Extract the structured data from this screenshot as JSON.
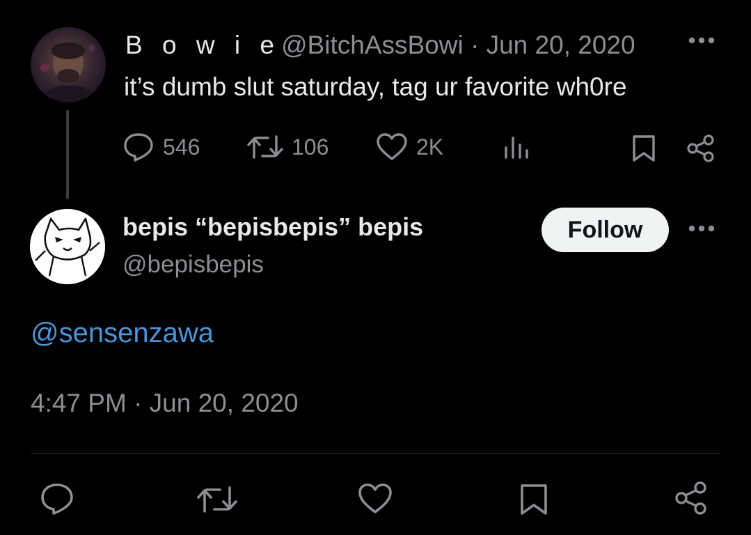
{
  "parent_tweet": {
    "display_name": "B o w i e",
    "handle": "@BitchAssBowi",
    "separator": "·",
    "date": "Jun 20, 2020",
    "text": "it’s dumb slut saturday, tag ur favorite wh0re",
    "actions": {
      "reply_count": "546",
      "retweet_count": "106",
      "like_count": "2K"
    },
    "icons": [
      "reply-icon",
      "retweet-icon",
      "like-icon",
      "views-icon",
      "bookmark-icon",
      "share-icon",
      "more-icon"
    ]
  },
  "reply_tweet": {
    "display_name": "bepis “bepisbepis” bepis",
    "handle": "@bepisbepis",
    "follow_label": "Follow",
    "text": "@sensenzawa",
    "timestamp": "4:47 PM · Jun 20, 2020",
    "icons": [
      "reply-icon",
      "retweet-icon",
      "like-icon",
      "bookmark-icon",
      "share-icon",
      "more-icon"
    ]
  },
  "colors": {
    "background": "#000000",
    "text_primary": "#e7e9ea",
    "text_secondary": "#8b8f94",
    "mention": "#4a94d9",
    "follow_button_bg": "#eff3f4"
  }
}
